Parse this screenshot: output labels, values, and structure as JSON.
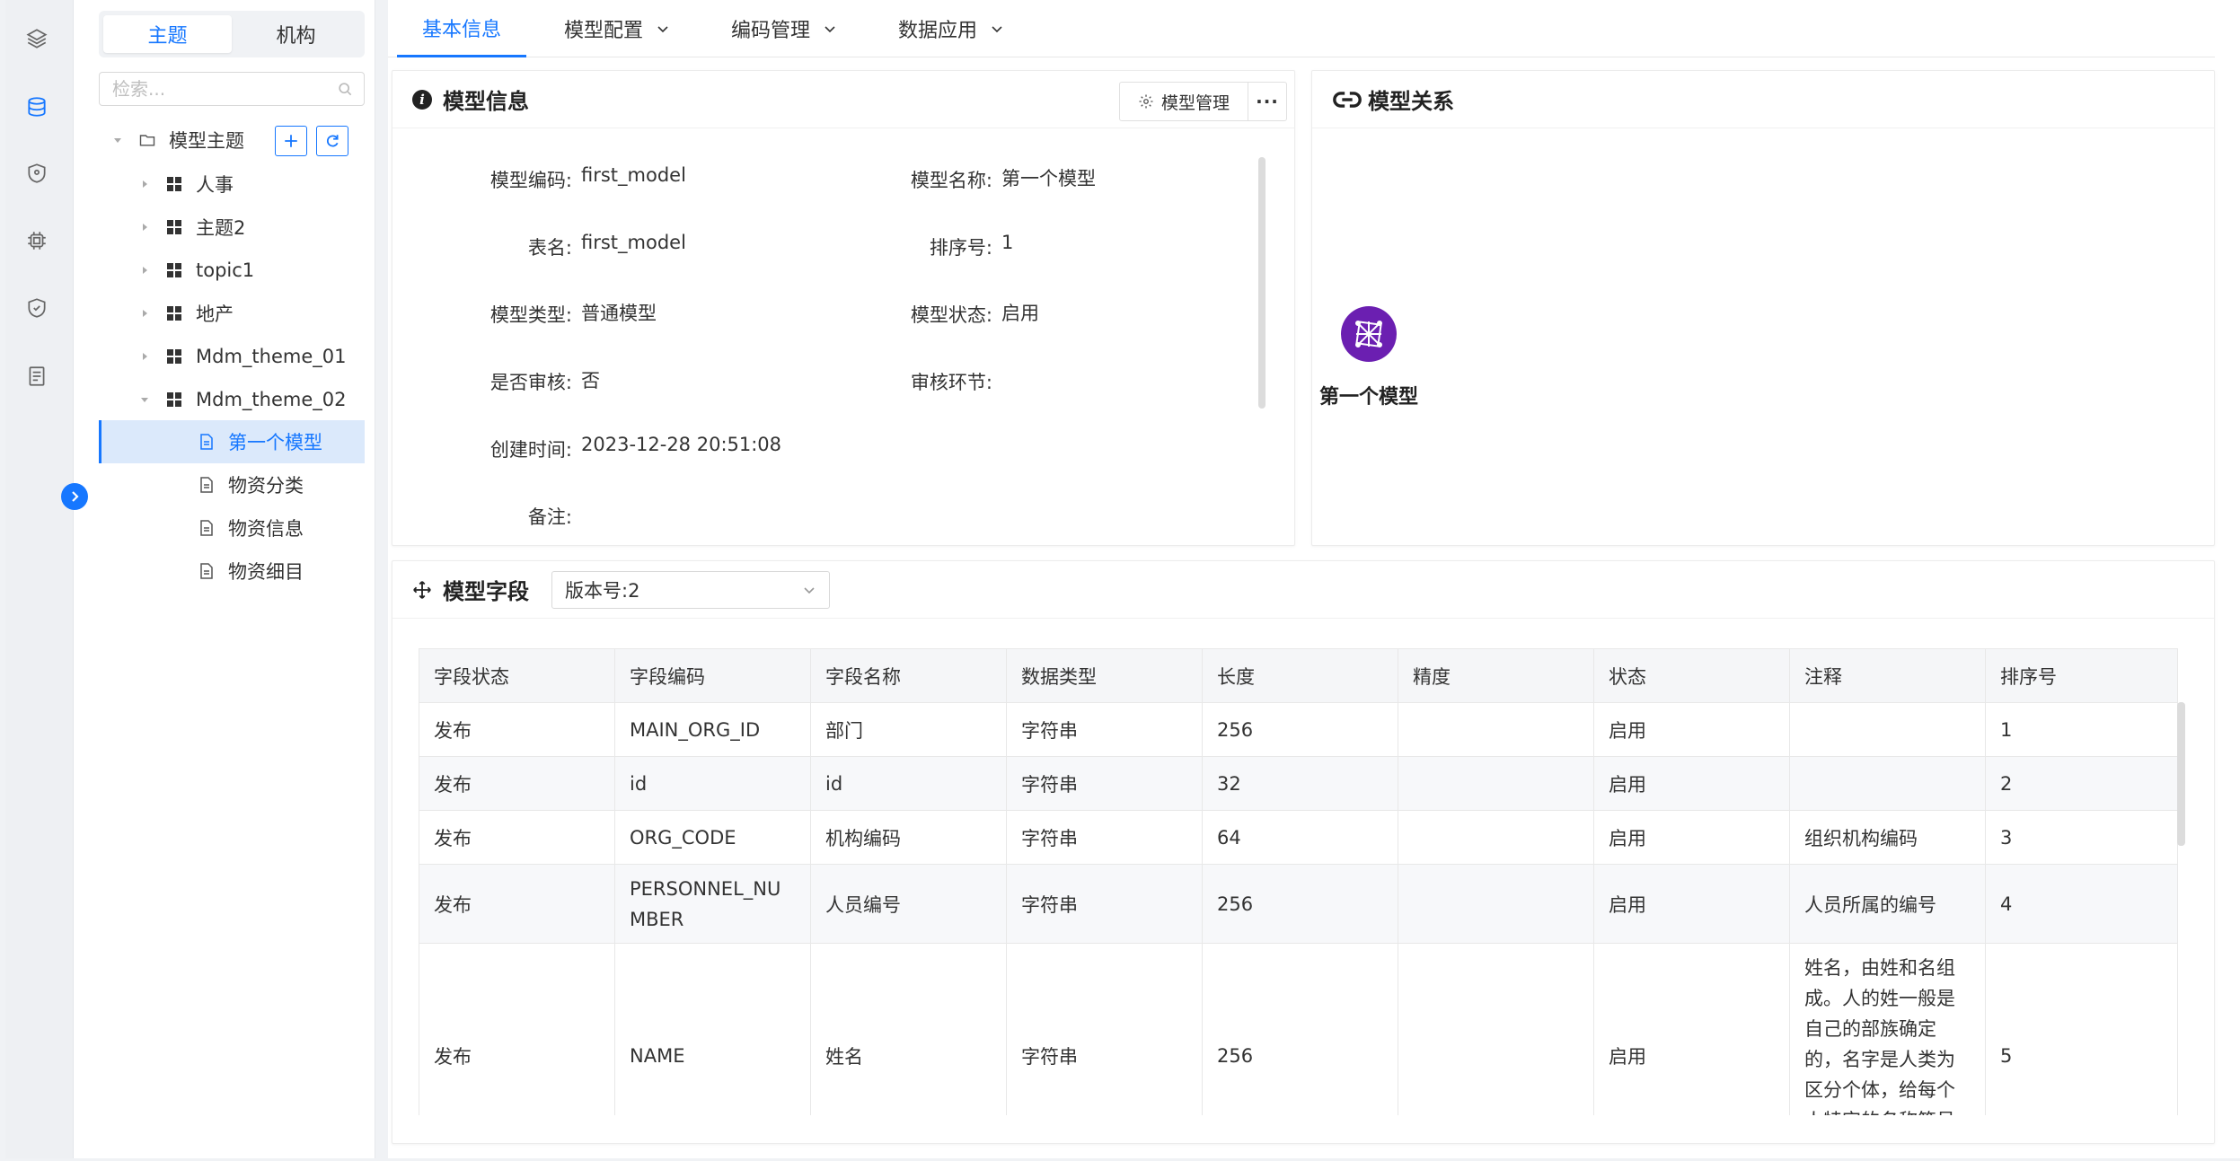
{
  "rail": {
    "icons": [
      "layers-icon",
      "database-icon",
      "shield-icon",
      "chip-icon",
      "security-icon",
      "document-icon"
    ]
  },
  "tree_panel": {
    "segments": [
      "主题",
      "机构"
    ],
    "search_placeholder": "检索...",
    "root": "模型主题",
    "nodes": [
      "人事",
      "主题2",
      "topic1",
      "地产",
      "Mdm_theme_01",
      "Mdm_theme_02"
    ],
    "leaves": [
      "第一个模型",
      "物资分类",
      "物资信息",
      "物资细目"
    ]
  },
  "tabs": [
    "基本信息",
    "模型配置",
    "编码管理",
    "数据应用"
  ],
  "model_info": {
    "title": "模型信息",
    "manage_button": "模型管理",
    "more_button": "···",
    "fields": {
      "code_label": "模型编码:",
      "code_value": "first_model",
      "name_label": "模型名称:",
      "name_value": "第一个模型",
      "table_label": "表名:",
      "table_value": "first_model",
      "sort_label": "排序号:",
      "sort_value": "1",
      "type_label": "模型类型:",
      "type_value": "普通模型",
      "status_label": "模型状态:",
      "status_value": "启用",
      "audit_label": "是否审核:",
      "audit_value": "否",
      "audit_step_label": "审核环节:",
      "created_label": "创建时间:",
      "created_value": "2023-12-28 20:51:08",
      "remark_label": "备注:"
    }
  },
  "relation": {
    "title": "模型关系",
    "node_label": "第一个模型",
    "node_color": "#6b1fb1"
  },
  "model_fields": {
    "title": "模型字段",
    "version": "版本号:2",
    "columns": [
      "字段状态",
      "字段编码",
      "字段名称",
      "数据类型",
      "长度",
      "精度",
      "状态",
      "注释",
      "排序号"
    ],
    "rows": [
      [
        "发布",
        "MAIN_ORG_ID",
        "部门",
        "字符串",
        "256",
        "",
        "启用",
        "",
        "1"
      ],
      [
        "发布",
        "id",
        "id",
        "字符串",
        "32",
        "",
        "启用",
        "",
        "2"
      ],
      [
        "发布",
        "ORG_CODE",
        "机构编码",
        "字符串",
        "64",
        "",
        "启用",
        "组织机构编码",
        "3"
      ],
      [
        "发布",
        "PERSONNEL_NUMBER",
        "人员编号",
        "字符串",
        "256",
        "",
        "启用",
        "人员所属的编号",
        "4"
      ],
      [
        "发布",
        "NAME",
        "姓名",
        "字符串",
        "256",
        "",
        "启用",
        "姓名，由姓和名组成。人的姓一般是自己的部族确定的，名字是人类为区分个体，给每个人特定的名称符号",
        "5"
      ]
    ]
  },
  "colors": {
    "accent": "#1677ff",
    "selected_bg": "#dbe9fb"
  }
}
